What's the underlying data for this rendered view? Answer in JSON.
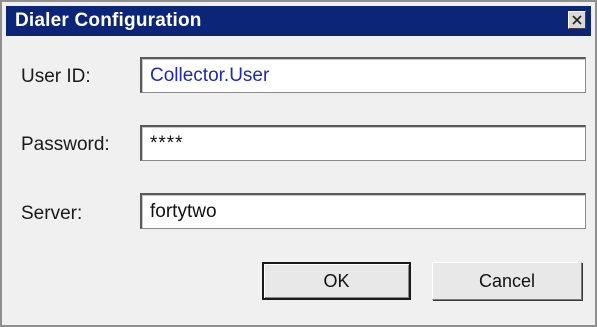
{
  "window": {
    "title": "Dialer Configuration",
    "close_icon": "close-icon"
  },
  "fields": {
    "user_id": {
      "label": "User ID:",
      "value": "Collector.User"
    },
    "password": {
      "label": "Password:",
      "value": "****"
    },
    "server": {
      "label": "Server:",
      "value": "fortytwo"
    }
  },
  "buttons": {
    "ok": "OK",
    "cancel": "Cancel"
  },
  "colors": {
    "titlebar": "#0d2576",
    "dialog_bg": "#f0f0f0",
    "userid_text": "#1b2bb5"
  }
}
